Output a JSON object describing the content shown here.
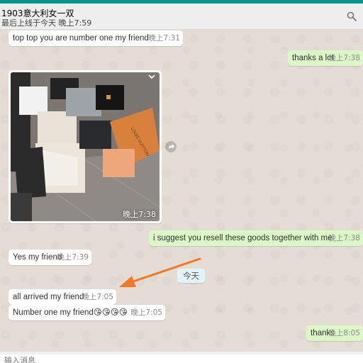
{
  "header": {
    "contact_name": "1903意大利女一双",
    "last_seen": "最后上线于今天 晚上7:59",
    "search_icon": "search-icon"
  },
  "messages": [
    {
      "dir": "in",
      "text": "top top you are number one my friend",
      "time": "晚上7:31"
    },
    {
      "dir": "out",
      "text": "thanks a lot",
      "time": "晚上7:38"
    },
    {
      "dir": "in",
      "type": "image",
      "time": "晚上7:38"
    },
    {
      "dir": "out",
      "text": "i suggest you resell these goods together with me",
      "time": "晚上7:38"
    },
    {
      "dir": "in",
      "text": "Yes my friend",
      "time": "晚上7:39"
    },
    {
      "dir": "in",
      "text": "all arrived my friend",
      "time": "晚上7:05"
    },
    {
      "dir": "in",
      "text": "Number one my friend😘😘😘😘",
      "time": "晚上7:05"
    },
    {
      "dir": "out",
      "text": "thanks",
      "time": "晚上8:05"
    }
  ],
  "date_divider": "今天",
  "image_photo": {
    "brand_text": "LOUIS VUITTON"
  },
  "composer": {
    "placeholder": "输入消息"
  },
  "colors": {
    "accent": "#009688",
    "outgoing_bubble": "#dcf8c6",
    "incoming_bubble": "#ffffff",
    "chat_bg": "#e5ddd5",
    "annotation_arrow": "#f27a27"
  }
}
